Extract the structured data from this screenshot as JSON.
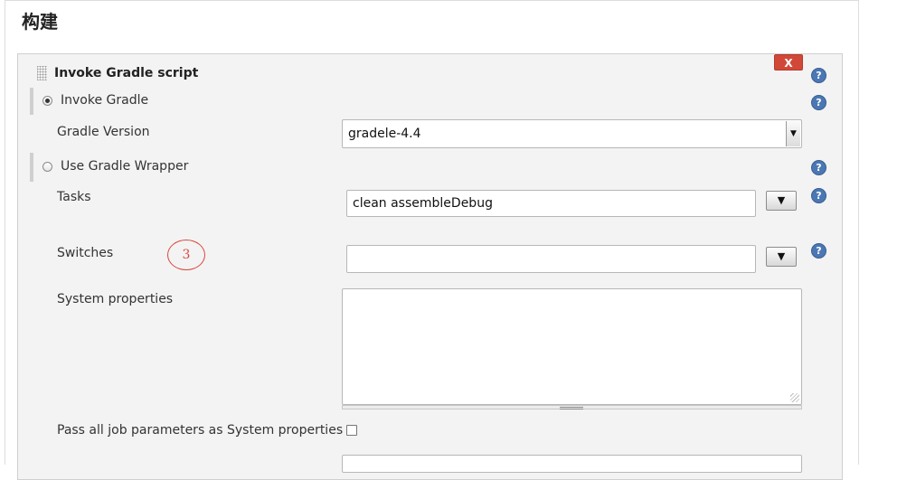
{
  "section": {
    "title": "构建"
  },
  "step": {
    "title": "Invoke Gradle script",
    "delete_label": "X",
    "help_glyph": "?"
  },
  "invoke_gradle": {
    "label": "Invoke Gradle",
    "checked": true,
    "gradle_version_label": "Gradle Version",
    "gradle_version_value": "gradele-4.4"
  },
  "wrapper": {
    "label": "Use Gradle Wrapper",
    "checked": false
  },
  "tasks": {
    "label": "Tasks",
    "value": "clean assembleDebug",
    "dropdown_glyph": "▼"
  },
  "switches": {
    "label": "Switches",
    "value": "",
    "dropdown_glyph": "▼"
  },
  "annotation": {
    "number": "3"
  },
  "system_properties": {
    "label": "System properties",
    "value": ""
  },
  "pass_params": {
    "label": "Pass all job parameters as System properties",
    "checked": false
  },
  "colors": {
    "help_icon": "#4b77b4",
    "delete_button": "#d24838",
    "annotation": "#d9473b",
    "panel_bg": "#f3f3f3"
  }
}
